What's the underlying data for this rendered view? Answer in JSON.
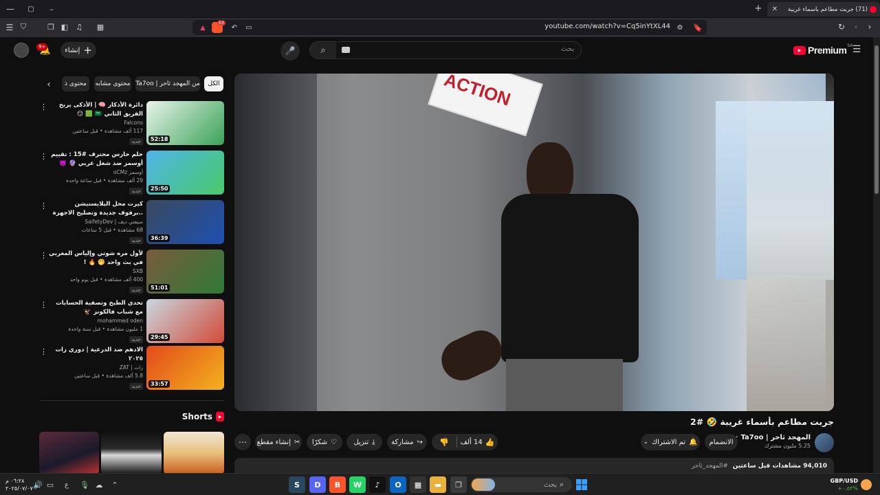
{
  "browser": {
    "tab_title": "(71) جربت مطاعم بأسماء غريبة",
    "url": "youtube.com/watch?v=Cq5inYtXL44",
    "ext_badge": "53"
  },
  "header": {
    "create_label": "إنشاء",
    "notif_count": "9+",
    "search_placeholder": "بحث",
    "logo_text": "Premium",
    "country": "SA"
  },
  "chips": [
    "الكل",
    "من المهجد ثاحر | Ta7oo",
    "محتوى مشابه",
    "محتوى ذ"
  ],
  "recommendations": [
    {
      "title": "دائرة الأذكار 🧠 | الأذكى يربح الفريق الثاني 🇸🇦 🟩 😏",
      "channel": "Falcons",
      "views": "117 ألف مشاهدة • قبل ساعتين",
      "new": "جديد",
      "duration": "52:18",
      "colors": [
        "#e9f3ea",
        "#3aa357"
      ]
    },
    {
      "title": "حلم حارس محترف #15 : تقييم أوسمز ضد شغل عربي 🔮 👿",
      "channel": "أوسمز oCMz",
      "views": "29 ألف مشاهدة • قبل ساعة واحدة",
      "new": "جديد",
      "duration": "25:50",
      "colors": [
        "#4fb5e8",
        "#49c96a"
      ]
    },
    {
      "title": "كيرت محل البلايستيشن ..برفوف جديدة وتصليح الاجهزة 🛠️ 🎮 #3",
      "channel": "سيفتي ديف | SaifetyDev",
      "views": "68 مشاهدة • قبل 5 ساعات",
      "new": "جديد",
      "duration": "36:39",
      "colors": [
        "#3b4a5e",
        "#1e4fb0"
      ]
    },
    {
      "title": "لأول مره شوتي وإلياس المغربي في بث واحد 🤭 🔥 !",
      "channel": "SXB",
      "views": "400 ألف مشاهدة • قبل يوم واحد",
      "new": "جديد",
      "duration": "51:01",
      "colors": [
        "#7a5a3c",
        "#2f7a3a"
      ]
    },
    {
      "title": "تحدي الطبخ وتصفية الحسابات مع شباب فالكونز 🦅",
      "channel": "mohammed oden",
      "views": "1 مليون مشاهدة • قبل سنة واحدة",
      "new": "جديد",
      "duration": "29:45",
      "colors": [
        "#c9d7e0",
        "#d14b3a"
      ]
    },
    {
      "title": "الادهم ضد الدرعية | دوري زات ٢٠٢٥",
      "channel": "زات | ZAT",
      "views": "5.8 ألف مشاهدة • قبل ساعتين",
      "new": "جديد",
      "duration": "33:57",
      "colors": [
        "#e24a1c",
        "#f4b21e"
      ]
    }
  ],
  "shorts": {
    "title": "Shorts"
  },
  "video": {
    "title": "جربت مطاعم بأسماء غريبة 🤣 #2",
    "sign_text": "ACTION",
    "channel": "المهجد ثاحر | Ta7oo",
    "subscribers": "5.25 مليون مشترك",
    "join_label": "الانضمام",
    "subscribed_label": "تم الاشتراك",
    "likes": "14 ألف",
    "share_label": "مشاركة",
    "download_label": "تنزيل",
    "thanks_label": "شكرًا",
    "clip_label": "إنشاء مقطع",
    "desc_views": "94,010 مشاهدات قبل ساعتين",
    "desc_tag": "#المهجد_ثاحر"
  },
  "taskbar": {
    "search_placeholder": "بحث",
    "currency_pair": "GBP/USD",
    "currency_change": "+٠.٥٣%",
    "clock_time": "٠٦:٢٨ م",
    "clock_date": "٢٠٢٥/٠٧/٠٧",
    "lang": "ع"
  },
  "colors": {
    "accent_red": "#ff0033",
    "bg": "#0f0f0f",
    "chip": "#272727"
  }
}
